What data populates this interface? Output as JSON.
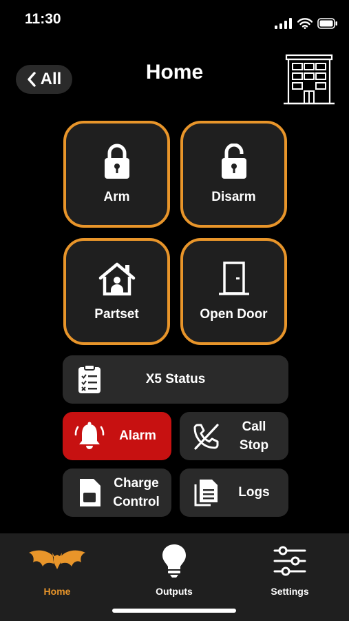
{
  "status_bar": {
    "time": "11:30"
  },
  "header": {
    "back_label": "All",
    "title": "Home"
  },
  "tiles": [
    {
      "label": "Arm"
    },
    {
      "label": "Disarm"
    },
    {
      "label": "Partset"
    },
    {
      "label": "Open Door"
    }
  ],
  "status_button": {
    "label": "X5 Status"
  },
  "actions": {
    "alarm_label": "Alarm",
    "call_stop_line1": "Call",
    "call_stop_line2": "Stop",
    "charge_line1": "Charge",
    "charge_line2": "Control",
    "logs_label": "Logs"
  },
  "tabs": [
    {
      "label": "Home",
      "active": true
    },
    {
      "label": "Outputs",
      "active": false
    },
    {
      "label": "Settings",
      "active": false
    }
  ],
  "colors": {
    "accent": "#e8952a",
    "alarm": "#c71111",
    "background": "#000000",
    "surface": "#2a2a2a"
  }
}
